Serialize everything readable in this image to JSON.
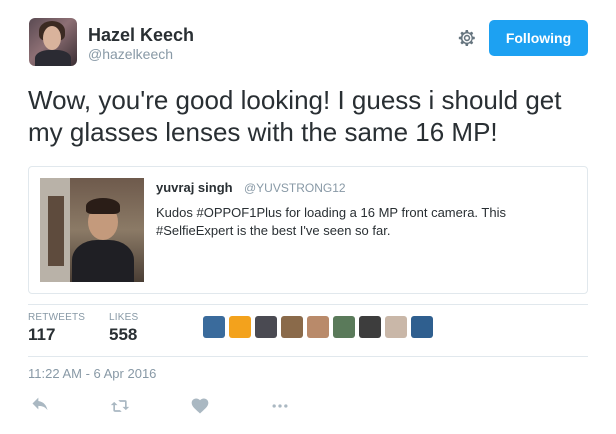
{
  "author": {
    "name": "Hazel Keech",
    "handle": "@hazelkeech",
    "follow_label": "Following"
  },
  "tweet": {
    "text": "Wow, you're good looking! I guess i should get my glasses lenses with the same 16 MP!",
    "timestamp": "11:22 AM - 6 Apr 2016"
  },
  "quoted": {
    "name": "yuvraj singh",
    "handle": "@YUVSTRONG12",
    "text": "Kudos #OPPOF1Plus for loading a 16 MP front camera. This #SelfieExpert is the best I've seen so far."
  },
  "stats": {
    "retweets_label": "RETWEETS",
    "retweets_value": "117",
    "likes_label": "LIKES",
    "likes_value": "558"
  },
  "likers": [
    "#3a6b9c",
    "#f3a21c",
    "#4a4a52",
    "#8a6a4a",
    "#b98a6a",
    "#5a7a5a",
    "#3d3d3d",
    "#c9b7a8",
    "#2f5f8f"
  ],
  "icons": [
    "gear-icon",
    "reply-icon",
    "retweet-icon",
    "like-icon",
    "more-icon"
  ],
  "colors": {
    "accent": "#1da1f2",
    "text": "#292f33",
    "muted": "#8899a6",
    "border": "#e1e8ed"
  }
}
